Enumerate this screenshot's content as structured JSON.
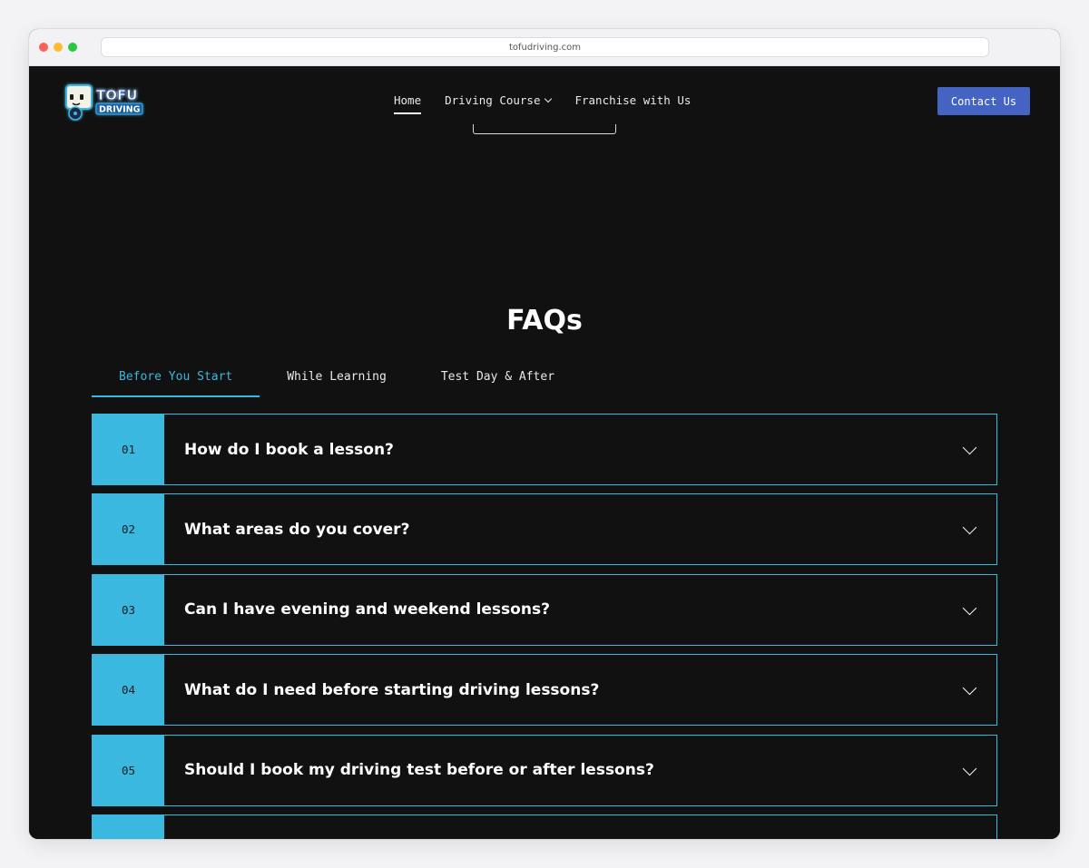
{
  "browser": {
    "url": "tofudriving.com"
  },
  "header": {
    "logo": {
      "line1": "TOFU",
      "line2": "DRIVING"
    },
    "nav": [
      {
        "label": "Home",
        "active": true
      },
      {
        "label": "Driving Course",
        "has_dropdown": true
      },
      {
        "label": "Franchise with Us"
      }
    ],
    "contact_label": "Contact Us"
  },
  "faq": {
    "title": "FAQs",
    "tabs": [
      {
        "label": "Before You Start",
        "active": true
      },
      {
        "label": "While Learning"
      },
      {
        "label": "Test Day & After"
      }
    ],
    "items": [
      {
        "num": "01",
        "question": "How do I book a lesson?"
      },
      {
        "num": "02",
        "question": "What areas do you cover?"
      },
      {
        "num": "03",
        "question": "Can I have evening and weekend lessons?"
      },
      {
        "num": "04",
        "question": "What do I need before starting driving lessons?"
      },
      {
        "num": "05",
        "question": "Should I book my driving test before or after lessons?"
      },
      {
        "num": "",
        "question": ""
      }
    ]
  },
  "colors": {
    "accent": "#3ab8e0",
    "button": "#4463c2",
    "background": "#111111"
  },
  "icons": {
    "dropdown": "chevron-down-icon",
    "accordion": "chevron-down-icon"
  }
}
